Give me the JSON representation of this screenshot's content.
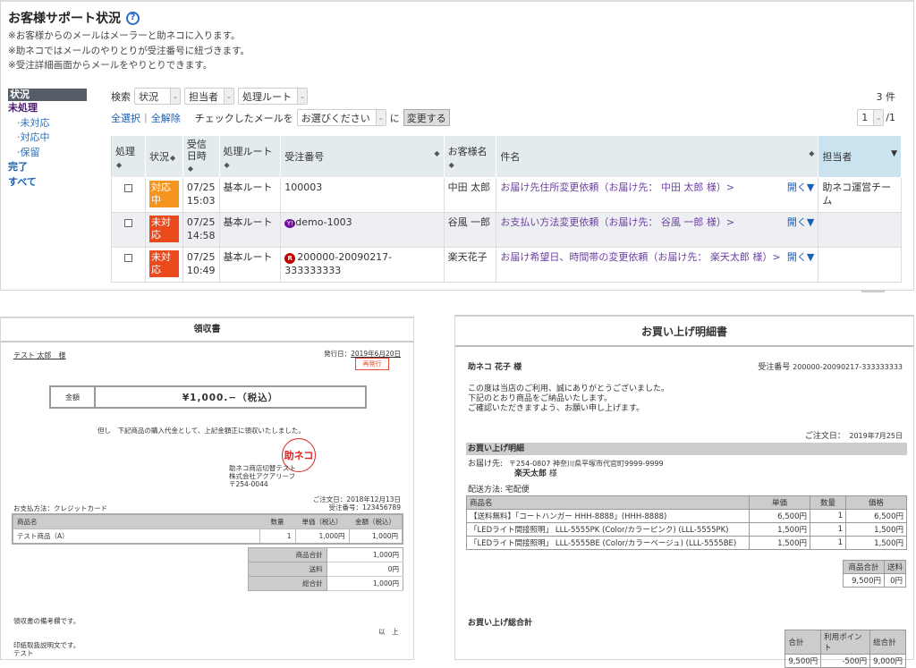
{
  "support": {
    "title": "お客様サポート状況",
    "help_icon": "question-circle-icon",
    "notes": [
      "※お客様からのメールはメーラーと助ネコに入ります。",
      "※助ネコではメールのやりとりが受注番号に紐づきます。",
      "※受注詳細画面からメールをやりとりできます。"
    ],
    "sidebar": {
      "header": "状況",
      "items": [
        {
          "label": "未処理",
          "active": true
        },
        {
          "label": "未対応",
          "sub": true
        },
        {
          "label": "対応中",
          "sub": true
        },
        {
          "label": "保留",
          "sub": true
        },
        {
          "label": "完了"
        },
        {
          "label": "すべて"
        }
      ]
    },
    "filters": {
      "search_label": "検索",
      "status": "状況",
      "assignee": "担当者",
      "route": "処理ルート"
    },
    "actions": {
      "select_all": "全選択",
      "separator": "|",
      "deselect_all": "全解除",
      "checked_label": "チェックしたメールを",
      "bulk_select": "お選びください",
      "to_label": "に",
      "change_button": "変更する"
    },
    "count": "3 件",
    "pager": {
      "current": "1",
      "total": "/1"
    },
    "columns": [
      "処理",
      "状況",
      "受信日時",
      "処理ルート",
      "受注番号",
      "お客様名",
      "件名",
      "担当者"
    ],
    "open_label": "開く▼",
    "rows": [
      {
        "status": "対応中",
        "status_color": "#f5951f",
        "date": "07/25",
        "time": "15:03",
        "route": "基本ルート",
        "order_no": "100003",
        "mall": "",
        "customer": "中田 太郎",
        "subject": "お届け先住所変更依頼（お届け先： 中田 太郎 様）>",
        "assignee": "助ネコ運営チーム"
      },
      {
        "status": "未対応",
        "status_color": "#ea4a1c",
        "date": "07/25",
        "time": "14:58",
        "route": "基本ルート",
        "order_no": "demo-1003",
        "mall": "yahoo",
        "customer": "谷風 一郎",
        "subject": "お支払い方法変更依頼（お届け先： 谷風 一郎 様）>",
        "assignee": ""
      },
      {
        "status": "未対応",
        "status_color": "#ea4a1c",
        "date": "07/25",
        "time": "10:49",
        "route": "基本ルート",
        "order_no": "200000-20090217-333333333",
        "mall": "rakuten",
        "customer": "楽天花子",
        "subject": "お届け希望日、時間帯の変更依頼（お届け先： 楽天太郎 様）>",
        "assignee": ""
      }
    ]
  },
  "receipt": {
    "title": "領収書",
    "recipient": "テスト 太郎　様",
    "issue_date_label": "発行日：",
    "issue_date": "2019年6月20日",
    "reissue": "再発行",
    "amount_label": "金額",
    "amount": "¥1,000.−（税込）",
    "proviso": "但し　下記商品の購入代金として、上記金額正に領収いたしました。",
    "stamp": "助ネコ",
    "issuer": [
      "助ネコ商店切替テスト",
      "株式会社アクアリーフ",
      "〒254-0044"
    ],
    "order_date_label": "ご注文日：",
    "order_date": "2018年12月13日",
    "order_no_label": "受注番号：",
    "order_no": "123456789",
    "payment_label": "お支払方法：",
    "payment": "クレジットカード",
    "item_columns": [
      "商品名",
      "数量",
      "単価（税込）",
      "金額（税込）"
    ],
    "items": [
      {
        "name": "テスト商品（A）",
        "qty": "1",
        "unit": "1,000円",
        "amount": "1,000円"
      }
    ],
    "totals": [
      {
        "label": "商品合計",
        "value": "1,000円"
      },
      {
        "label": "送料",
        "value": "0円"
      },
      {
        "label": "総合計",
        "value": "1,000円"
      }
    ],
    "remarks": "領収書の備考欄です。",
    "end": "以　上",
    "stamp_note": [
      "印紙取扱説明文です。",
      "テスト"
    ]
  },
  "statement": {
    "title": "お買い上げ明細書",
    "recipient": "助ネコ 花子 様",
    "order_no_label": "受注番号",
    "order_no": "200000-20090217-333333333",
    "greeting": [
      "この度は当店のご利用、誠にありがとうございました。",
      "下記のとおり商品をご納品いたします。",
      "ご確認いただきますよう、お願い申し上げます。"
    ],
    "order_date_label": "ご注文日：",
    "order_date": "2019年7月25日",
    "section_title": "お買い上げ明細",
    "ship_to_label": "お届け先:",
    "ship_to_address": "〒254-0807 神奈川県平塚市代官町9999-9999",
    "ship_to_name": "楽天太郎",
    "honorific": "様",
    "delivery_label": "配送方法:",
    "delivery": "宅配便",
    "item_columns": [
      "商品名",
      "単価",
      "数量",
      "価格"
    ],
    "items": [
      {
        "name": "【送料無料】「コートハンガー HHH-8888」(HHH-8888)",
        "unit": "6,500円",
        "qty": "1",
        "price": "6,500円"
      },
      {
        "name": "「LEDライト間接照明」 LLL-5555PK (Color/カラーピンク) (LLL-5555PK)",
        "unit": "1,500円",
        "qty": "1",
        "price": "1,500円"
      },
      {
        "name": "「LEDライト間接照明」 LLL-5555BE (Color/カラーベージュ) (LLL-5555BE)",
        "unit": "1,500円",
        "qty": "1",
        "price": "1,500円"
      }
    ],
    "subtotal_columns": [
      "商品合計",
      "送料"
    ],
    "subtotal_values": [
      "9,500円",
      "0円"
    ],
    "grand_title": "お買い上げ総合計",
    "grand_columns": [
      "合計",
      "利用ポイント",
      "総合計"
    ],
    "grand_values": [
      "9,500円",
      "-500円",
      "9,000円"
    ]
  }
}
